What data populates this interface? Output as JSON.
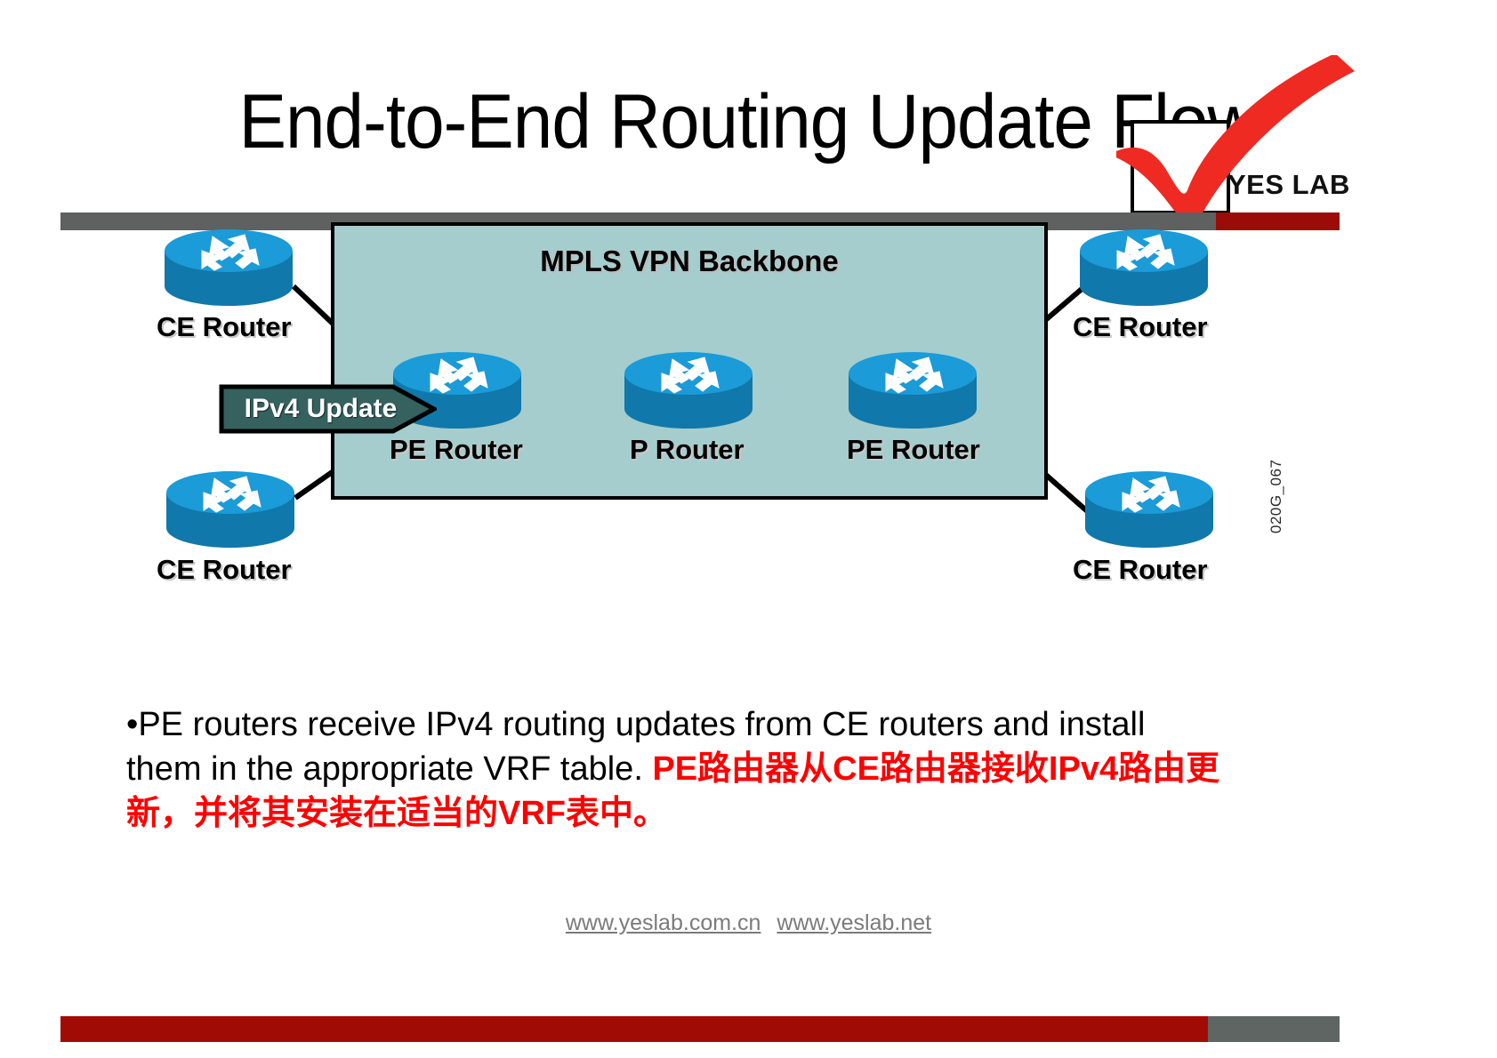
{
  "slide": {
    "title": "End-to-End Routing Update Flow",
    "logo": {
      "text": "YES LAB",
      "check_icon": "red-checkmark-icon",
      "brand_red": "#ee2a23"
    },
    "bars": {
      "top_gray": "#5f6060",
      "top_red": "#9b0b07",
      "bottom_red": "#a00b06",
      "bottom_gray": "#5f6563"
    }
  },
  "diagram": {
    "backbone_label": "MPLS VPN Backbone",
    "backbone_fill": "#a5cdcd",
    "router_color": "#1b9bd8",
    "badge": {
      "label": "IPv4 Update",
      "fill": "#35615f"
    },
    "code_label": "020G_067",
    "routers": [
      {
        "id": "ce-top-left",
        "label": "CE Router",
        "icon": "router-icon"
      },
      {
        "id": "ce-bottom-left",
        "label": "CE Router",
        "icon": "router-icon"
      },
      {
        "id": "pe-left",
        "label": "PE Router",
        "icon": "router-icon"
      },
      {
        "id": "p-center",
        "label": "P Router",
        "icon": "router-icon"
      },
      {
        "id": "pe-right",
        "label": "PE Router",
        "icon": "router-icon"
      },
      {
        "id": "ce-top-right",
        "label": "CE Router",
        "icon": "router-icon"
      },
      {
        "id": "ce-bottom-right",
        "label": "CE Router",
        "icon": "router-icon"
      }
    ]
  },
  "body": {
    "bullet": "•",
    "english": "PE routers receive IPv4 routing updates from CE routers and install them in the appropriate VRF table. ",
    "chinese": "PE路由器从CE路由器接收IPv4路由更新，并将其安装在适当的VRF表中。"
  },
  "footer": {
    "links": [
      {
        "label": "www.yeslab.com.cn"
      },
      {
        "label": "www.yeslab.net"
      }
    ]
  }
}
